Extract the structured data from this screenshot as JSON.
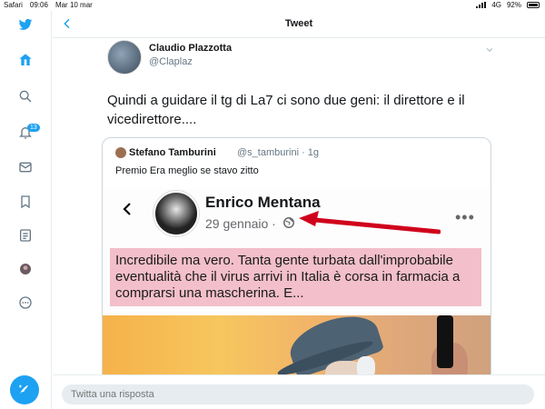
{
  "statusbar": {
    "app": "Safari",
    "time": "09:06",
    "date": "Mar 10 mar",
    "network": "4G",
    "battery": "92%"
  },
  "header": {
    "title": "Tweet"
  },
  "sidebar": {
    "items": [
      {
        "name": "twitter-logo-icon"
      },
      {
        "name": "home-icon"
      },
      {
        "name": "explore-icon"
      },
      {
        "name": "notifications-icon",
        "badge": "13"
      },
      {
        "name": "messages-icon"
      },
      {
        "name": "bookmarks-icon"
      },
      {
        "name": "lists-icon"
      },
      {
        "name": "profile-avatar"
      },
      {
        "name": "more-icon"
      }
    ],
    "compose": "compose-tweet-icon"
  },
  "tweet": {
    "author_name": "Claudio Plazzotta",
    "author_handle": "@Claplaz",
    "text": "Quindi a guidare il tg di La7 ci sono due geni: il direttore e il vicedirettore....",
    "quote": {
      "author_name": "Stefano Tamburini",
      "author_handle": "@s_tamburini · 1g",
      "text": "Premio Era meglio se stavo zitto",
      "screenshot": {
        "name": "Enrico Mentana",
        "date": "29 gennaio ·",
        "body": "Incredibile ma vero. Tanta gente turbata dall'improbabile eventualità che il virus arrivi in Italia è corsa in farmacia a comprarsi una mascherina. E..."
      }
    }
  },
  "reply": {
    "placeholder": "Twitta una risposta"
  },
  "colors": {
    "accent": "#1da1f2",
    "highlight": "#f2bfca",
    "arrow": "#d0021b"
  }
}
